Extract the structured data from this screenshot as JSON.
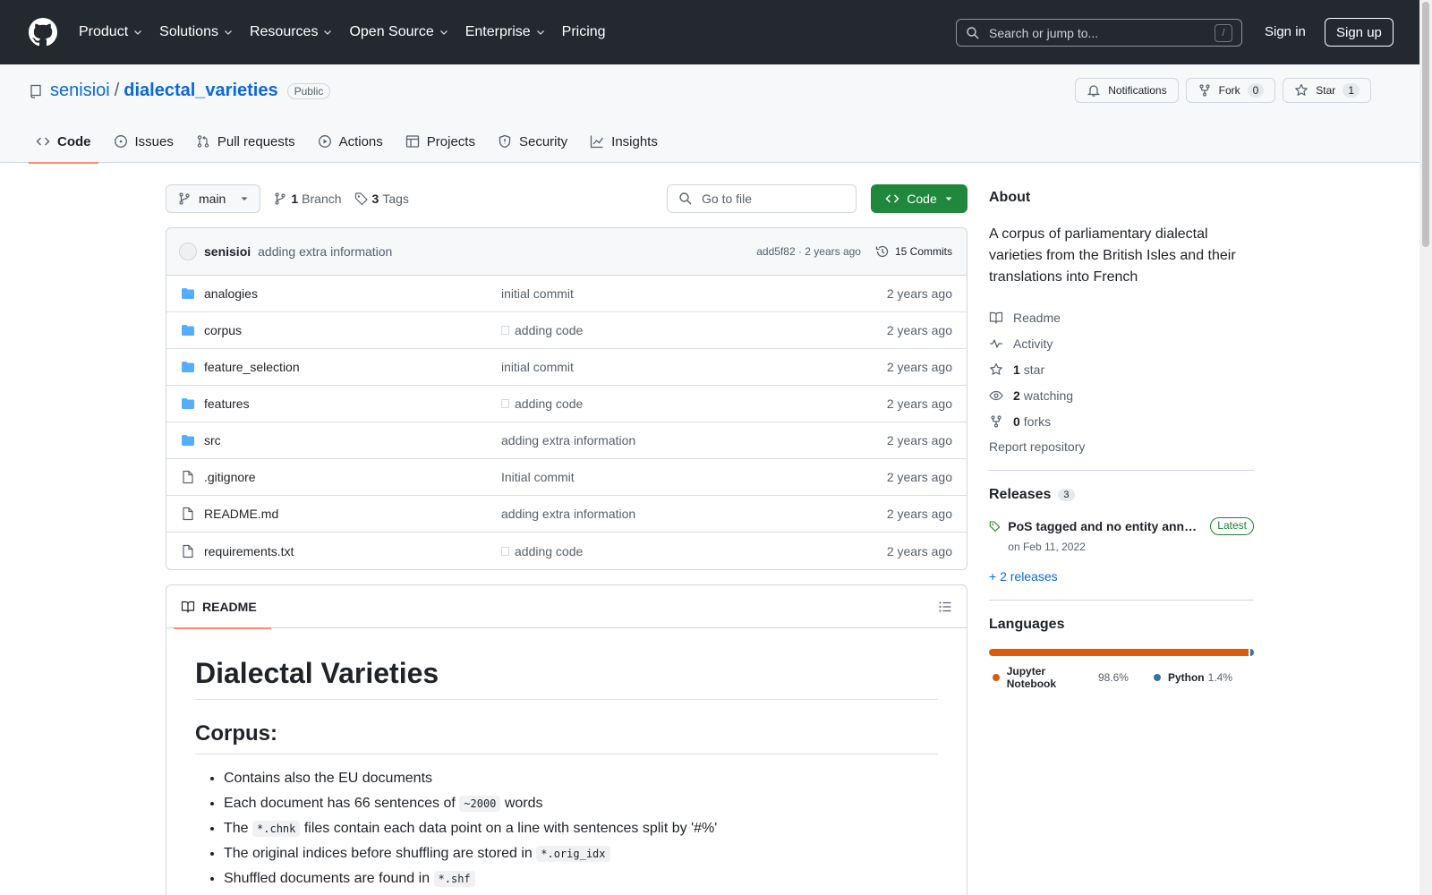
{
  "header": {
    "nav": [
      "Product",
      "Solutions",
      "Resources",
      "Open Source",
      "Enterprise",
      "Pricing"
    ],
    "search_placeholder": "Search or jump to...",
    "search_shortcut": "/",
    "sign_in": "Sign in",
    "sign_up": "Sign up"
  },
  "repo": {
    "owner": "senisioi",
    "separator": "/",
    "name": "dialectal_varieties",
    "visibility": "Public",
    "notifications": "Notifications",
    "fork_label": "Fork",
    "fork_count": "0",
    "star_label": "Star",
    "star_count": "1",
    "tabs": [
      "Code",
      "Issues",
      "Pull requests",
      "Actions",
      "Projects",
      "Security",
      "Insights"
    ]
  },
  "toolbar": {
    "branch": "main",
    "branch_count": "1",
    "branch_label": "Branch",
    "tag_count": "3",
    "tag_label": "Tags",
    "goto_placeholder": "Go to file",
    "code_button": "Code"
  },
  "commit": {
    "author": "senisioi",
    "message": "adding extra information",
    "hash_time": "add5f82 · 2 years ago",
    "commits": "15 Commits"
  },
  "files": [
    {
      "name": "analogies",
      "type": "folder",
      "message": "initial commit",
      "marker": false,
      "age": "2 years ago"
    },
    {
      "name": "corpus",
      "type": "folder",
      "message": "adding code",
      "marker": true,
      "age": "2 years ago"
    },
    {
      "name": "feature_selection",
      "type": "folder",
      "message": "initial commit",
      "marker": false,
      "age": "2 years ago"
    },
    {
      "name": "features",
      "type": "folder",
      "message": "adding code",
      "marker": true,
      "age": "2 years ago"
    },
    {
      "name": "src",
      "type": "folder",
      "message": "adding extra information",
      "marker": false,
      "age": "2 years ago"
    },
    {
      "name": ".gitignore",
      "type": "file",
      "message": "Initial commit",
      "marker": false,
      "age": "2 years ago"
    },
    {
      "name": "README.md",
      "type": "file",
      "message": "adding extra information",
      "marker": false,
      "age": "2 years ago"
    },
    {
      "name": "requirements.txt",
      "type": "file",
      "message": "adding code",
      "marker": true,
      "age": "2 years ago"
    }
  ],
  "readme": {
    "tab": "README",
    "h1": "Dialectal Varieties",
    "h2": "Corpus:",
    "items": [
      {
        "before": "Contains also the EU documents",
        "code": "",
        "after": ""
      },
      {
        "before": "Each document has 66 sentences of ",
        "code": "~2000",
        "after": " words"
      },
      {
        "before": "The ",
        "code": "*.chnk",
        "after": " files contain each data point on a line with sentences split by '#%'"
      },
      {
        "before": "The original indices before shuffling are stored in ",
        "code": "*.orig_idx",
        "after": ""
      },
      {
        "before": "Shuffled documents are found in ",
        "code": "*.shf",
        "after": ""
      }
    ]
  },
  "about": {
    "title": "About",
    "description": "A corpus of parliamentary dialectal varieties from the British Isles and their translations into French",
    "readme": "Readme",
    "activity": "Activity",
    "stars_count": "1",
    "stars_label": "star",
    "watching_count": "2",
    "watching_label": "watching",
    "forks_count": "0",
    "forks_label": "forks",
    "report": "Report repository"
  },
  "releases": {
    "title": "Releases",
    "count": "3",
    "latest_name": "PoS tagged and no entity annotations",
    "latest_badge": "Latest",
    "latest_date": "on Feb 11, 2022",
    "more": "+ 2 releases"
  },
  "languages": {
    "title": "Languages",
    "items": [
      {
        "name": "Jupyter Notebook",
        "percent": "98.6%",
        "value": 98.6,
        "color": "#DA5B0B"
      },
      {
        "name": "Python",
        "percent": "1.4%",
        "value": 1.4,
        "color": "#3572A5"
      }
    ]
  },
  "colors": {
    "header_bg": "#24292f",
    "link": "#0969da",
    "code_button": "#1f883d",
    "active_tab_underline": "#fd8c73",
    "folder_icon": "#54aeff"
  }
}
